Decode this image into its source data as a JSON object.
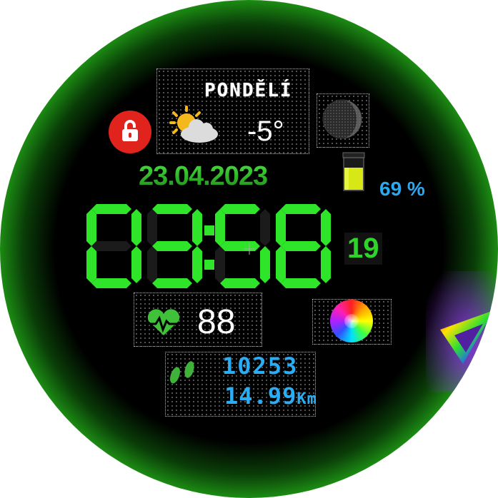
{
  "weekday": "PONDĚLÍ",
  "temperature": "-5°",
  "date": "23.04.2023",
  "battery": {
    "percent_label": "69 %",
    "level": 0.69
  },
  "time": {
    "hours": "03",
    "minutes": "58",
    "seconds": "19"
  },
  "heart_rate": "88",
  "steps": "10253",
  "distance": {
    "value": "14.99",
    "unit": "Km"
  },
  "icons": {
    "lock": "lock-icon",
    "weather": "partly-cloudy-icon",
    "moon": "moon-phase-icon",
    "battery": "battery-icon",
    "heart": "heart-rate-icon",
    "color": "color-wheel-icon",
    "steps": "footprints-icon"
  },
  "colors": {
    "accent_green": "#2fd42a",
    "accent_blue": "#29aef5",
    "lock_red": "#e0231c"
  }
}
